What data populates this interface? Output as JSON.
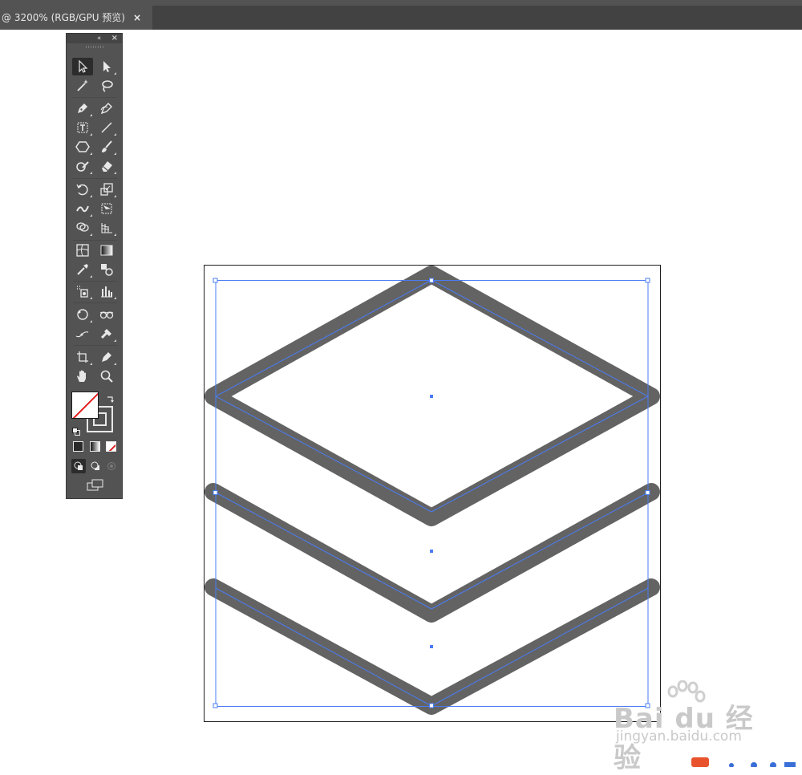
{
  "document_tab": {
    "title": "@ 3200% (RGB/GPU 预览)",
    "close_glyph": "×"
  },
  "toolbox": {
    "collapse_glyph": "‹‹",
    "close_glyph": "×",
    "tools": [
      {
        "name": "selection-tool",
        "icon": "arrow-icon"
      },
      {
        "name": "direct-selection-tool",
        "icon": "white-arrow-icon"
      },
      {
        "name": "magic-wand-tool",
        "icon": "magic-wand-icon"
      },
      {
        "name": "lasso-tool",
        "icon": "lasso-icon"
      },
      {
        "name": "pen-tool",
        "icon": "pen-icon"
      },
      {
        "name": "curvature-tool",
        "icon": "curvature-pen-icon"
      },
      {
        "name": "type-tool",
        "icon": "text-frame-icon"
      },
      {
        "name": "line-segment-tool",
        "icon": "line-icon"
      },
      {
        "name": "polygon-tool",
        "icon": "hexagon-icon"
      },
      {
        "name": "paintbrush-tool",
        "icon": "brush-icon"
      },
      {
        "name": "shaper-tool",
        "icon": "shaper-icon"
      },
      {
        "name": "eraser-tool",
        "icon": "eraser-icon"
      },
      {
        "name": "rotate-tool",
        "icon": "rotate-icon"
      },
      {
        "name": "scale-tool",
        "icon": "scale-icon"
      },
      {
        "name": "width-tool",
        "icon": "width-icon"
      },
      {
        "name": "free-transform-tool",
        "icon": "free-transform-icon"
      },
      {
        "name": "shape-builder-tool",
        "icon": "shape-builder-icon"
      },
      {
        "name": "perspective-grid-tool",
        "icon": "perspective-grid-icon"
      },
      {
        "name": "mesh-tool",
        "icon": "mesh-icon"
      },
      {
        "name": "gradient-tool",
        "icon": "gradient-icon"
      },
      {
        "name": "eyedropper-tool",
        "icon": "eyedropper-icon"
      },
      {
        "name": "blend-tool",
        "icon": "blend-icon"
      },
      {
        "name": "symbol-sprayer-tool",
        "icon": "symbol-sprayer-icon"
      },
      {
        "name": "column-graph-tool",
        "icon": "column-graph-icon"
      },
      {
        "name": "puppet-warp-tool",
        "icon": "puppet-warp-icon"
      },
      {
        "name": "artboard-link-tool",
        "icon": "glasses-icon"
      },
      {
        "name": "slice-path-tool",
        "icon": "path-icon"
      },
      {
        "name": "live-paint-tool",
        "icon": "live-paint-icon"
      },
      {
        "name": "artboard-tool",
        "icon": "artboard-icon"
      },
      {
        "name": "edit-pen-tool",
        "icon": "pen-nib-icon"
      },
      {
        "name": "hand-tool",
        "icon": "hand-icon"
      },
      {
        "name": "zoom-tool",
        "icon": "magnifier-icon"
      }
    ],
    "fill_color": "#ffffff",
    "stroke_color": "none",
    "accent_none_color": "#e02020"
  },
  "canvas": {
    "artwork_stroke_color": "#636363",
    "selection_color": "#4a7cf5",
    "artboard_border_color": "#1e1e1e"
  },
  "watermark": {
    "brand_text": "Bai du 经验",
    "url_text": "jingyan.baidu.com"
  }
}
